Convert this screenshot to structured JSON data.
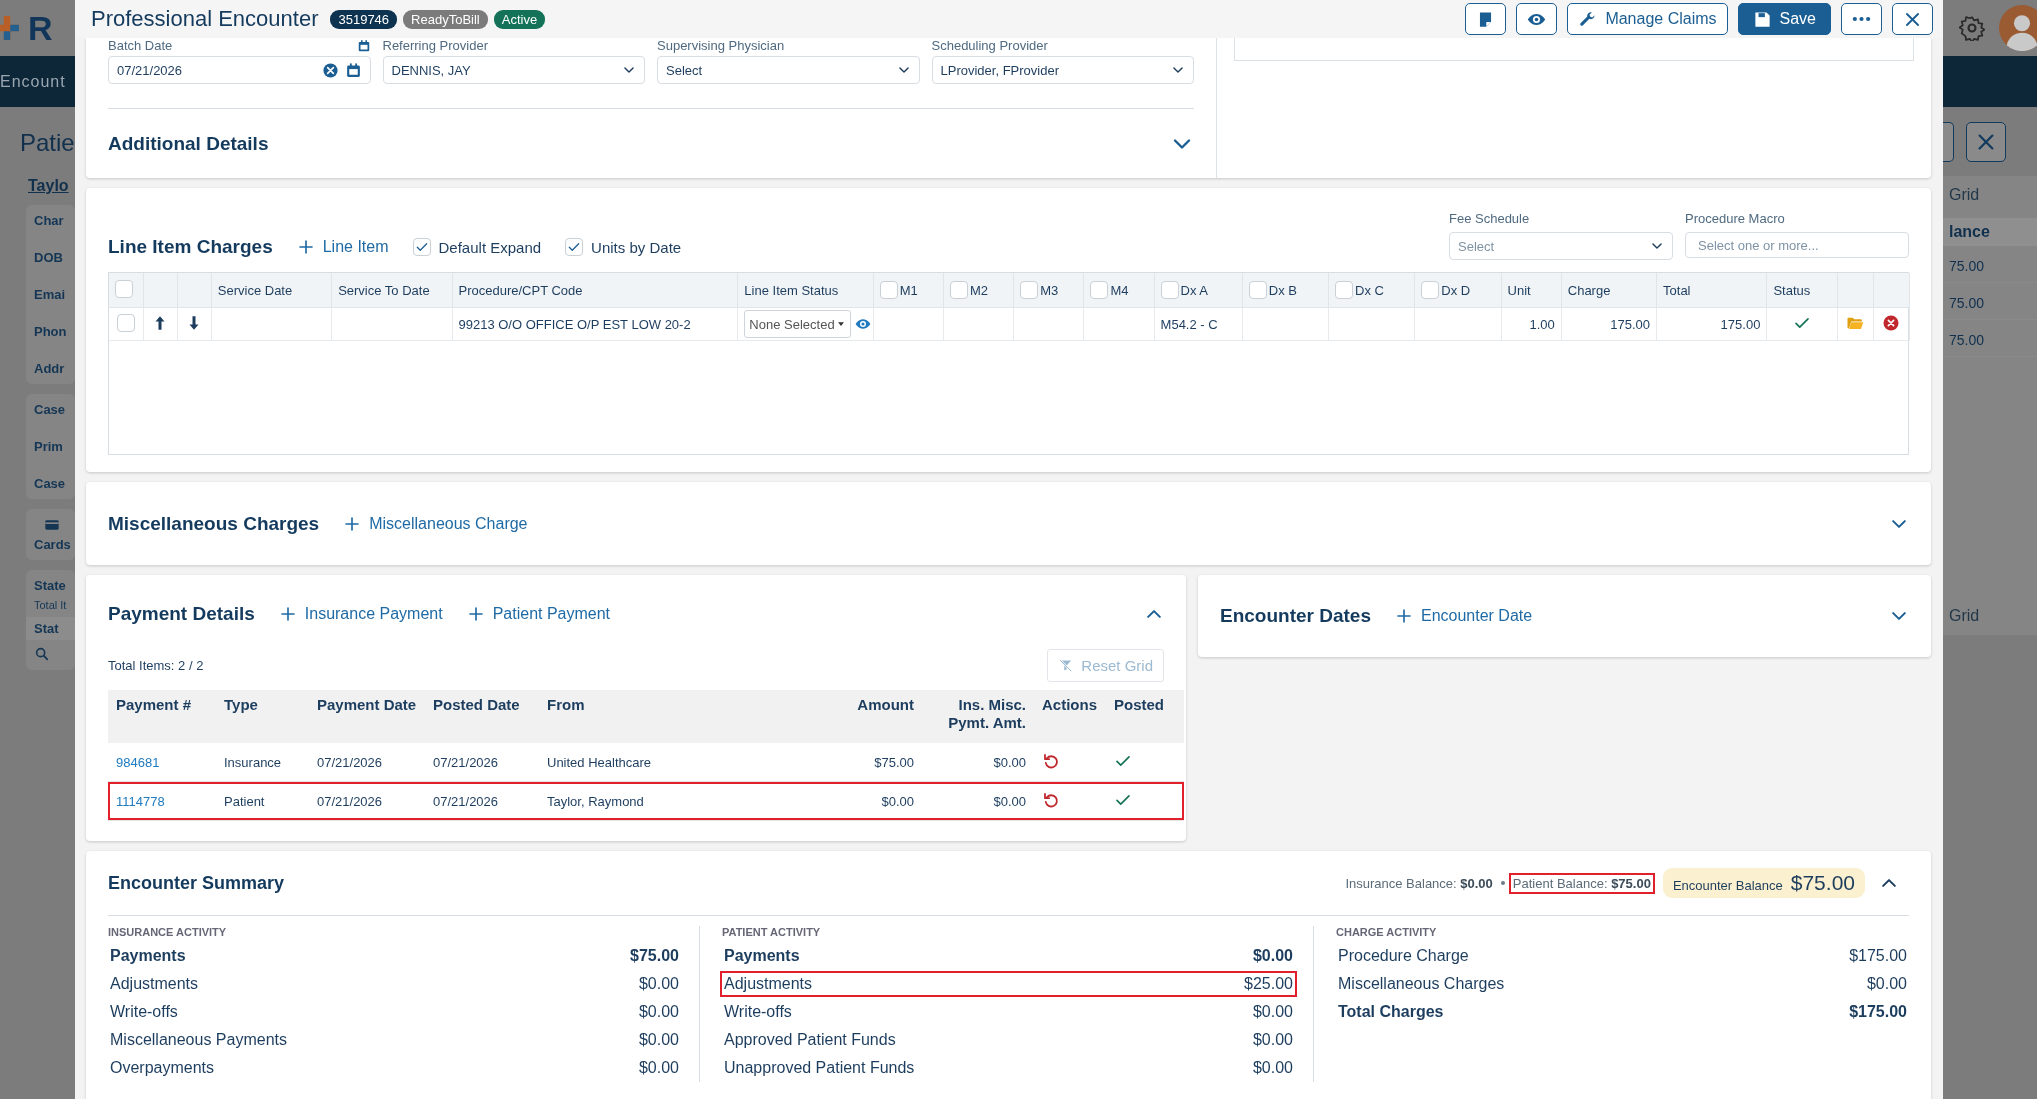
{
  "backdrop": {
    "left": {
      "logo_letter": "R",
      "nav_label": "Encount",
      "page_title": "Patie",
      "patient_name": "Taylo",
      "info_labels": [
        "Char",
        "DOB",
        "Emai",
        "Phon",
        "Addr"
      ],
      "case_labels": [
        "Case",
        "Prim",
        "Case"
      ],
      "cards_label": "Cards",
      "statements": {
        "title": "State",
        "total": "Total It",
        "column": "Stat"
      }
    },
    "right": {
      "grid_link": "Grid",
      "column": "lance",
      "values": [
        "75.00",
        "75.00",
        "75.00"
      ],
      "grid_link_2": "Grid"
    }
  },
  "modal": {
    "title": "Professional Encounter",
    "badges": [
      {
        "text": "3519746",
        "color": "#0d3350"
      },
      {
        "text": "ReadyToBill",
        "color": "#7b7b7b"
      },
      {
        "text": "Active",
        "color": "#137257"
      }
    ],
    "manage_claims": "Manage Claims",
    "save": "Save"
  },
  "encounter_info": {
    "fields": [
      {
        "label": "Batch Date",
        "value": "07/21/2026",
        "kind": "date"
      },
      {
        "label": "Referring Provider",
        "value": "DENNIS, JAY",
        "kind": "select"
      },
      {
        "label": "Supervising Physician",
        "value": "Select",
        "kind": "select"
      },
      {
        "label": "Scheduling Provider",
        "value": "LProvider, FProvider",
        "kind": "select"
      }
    ],
    "additional_details": {
      "title": "Additional Details",
      "expanded": false
    }
  },
  "line_items": {
    "title": "Line Item Charges",
    "add": "Line Item",
    "options": [
      {
        "label": "Default Expand",
        "checked": true
      },
      {
        "label": "Units by Date",
        "checked": true
      }
    ],
    "fee_schedule": {
      "label": "Fee Schedule",
      "value": "Select"
    },
    "procedure_macro": {
      "label": "Procedure Macro",
      "placeholder": "Select one or more..."
    },
    "select_all": {
      "checked": false
    },
    "columns": [
      {
        "label": "Service Date",
        "kind": "plain"
      },
      {
        "label": "Service To Date",
        "kind": "plain"
      },
      {
        "label": "Procedure/CPT Code",
        "kind": "plain"
      },
      {
        "label": "Line Item Status",
        "kind": "select"
      },
      {
        "label": "M1",
        "kind": "checkbox",
        "checked": false
      },
      {
        "label": "M2",
        "kind": "checkbox",
        "checked": false
      },
      {
        "label": "M3",
        "kind": "checkbox",
        "checked": false
      },
      {
        "label": "M4",
        "kind": "checkbox",
        "checked": false
      },
      {
        "label": "Dx A",
        "kind": "checkbox",
        "checked": false
      },
      {
        "label": "Dx B",
        "kind": "checkbox",
        "checked": false
      },
      {
        "label": "Dx C",
        "kind": "checkbox",
        "checked": false
      },
      {
        "label": "Dx D",
        "kind": "checkbox",
        "checked": false
      },
      {
        "label": "Unit",
        "kind": "number"
      },
      {
        "label": "Charge",
        "kind": "number"
      },
      {
        "label": "Total",
        "kind": "number"
      },
      {
        "label": "Status",
        "kind": "status"
      }
    ],
    "rows": [
      {
        "checked": false,
        "status_ok": true,
        "cells": [
          null,
          null,
          "99213 O/O OFFICE O/P EST LOW 20-2",
          "None Selected",
          null,
          null,
          null,
          null,
          "M54.2 - C",
          null,
          null,
          null,
          "1.00",
          "175.00",
          "175.00",
          null
        ]
      }
    ]
  },
  "misc_charges": {
    "title": "Miscellaneous Charges",
    "add": "Miscellaneous Charge",
    "expanded": false
  },
  "payment_details": {
    "title": "Payment Details",
    "add_insurance": "Insurance Payment",
    "add_patient": "Patient Payment",
    "expanded": true,
    "total_items": "Total Items: 2 / 2",
    "reset_grid": {
      "label": "Reset Grid",
      "disabled": true
    },
    "columns": [
      {
        "label": "Payment #",
        "kind": "link"
      },
      {
        "label": "Type",
        "kind": "plain"
      },
      {
        "label": "Payment Date",
        "kind": "plain"
      },
      {
        "label": "Posted Date",
        "kind": "plain"
      },
      {
        "label": "From",
        "kind": "plain"
      },
      {
        "label": "Amount",
        "kind": "number"
      },
      {
        "label": "Ins. Misc. Pymt. Amt.",
        "kind": "number"
      },
      {
        "label": "Actions",
        "kind": "action"
      },
      {
        "label": "Posted",
        "kind": "check"
      }
    ],
    "rows": [
      {
        "cells": [
          "984681",
          "Insurance",
          "07/21/2026",
          "07/21/2026",
          "United Healthcare",
          "$75.00",
          "$0.00",
          null,
          null
        ],
        "posted": true,
        "highlighted": false
      },
      {
        "cells": [
          "1114778",
          "Patient",
          "07/21/2026",
          "07/21/2026",
          "Taylor, Raymond",
          "$0.00",
          "$0.00",
          null,
          null
        ],
        "posted": true,
        "highlighted": true
      }
    ]
  },
  "encounter_dates": {
    "title": "Encounter Dates",
    "add": "Encounter Date",
    "expanded": false
  },
  "summary": {
    "title": "Encounter Summary",
    "expanded": true,
    "insurance_balance": {
      "text": "Insurance Balance: **$0.00**",
      "highlighted": false
    },
    "patient_balance": {
      "text": "Patient Balance: **$75.00**",
      "highlighted": true
    },
    "encounter_balance": {
      "label": "Encounter Balance",
      "value": "$75.00"
    },
    "groups": [
      {
        "title": "INSURANCE ACTIVITY",
        "rows": [
          {
            "label": "Payments",
            "value": "$75.00",
            "emphasis": true,
            "highlighted": false
          },
          {
            "label": "Adjustments",
            "value": "$0.00",
            "emphasis": false,
            "highlighted": false
          },
          {
            "label": "Write-offs",
            "value": "$0.00",
            "emphasis": false,
            "highlighted": false
          },
          {
            "label": "Miscellaneous Payments",
            "value": "$0.00",
            "emphasis": false,
            "highlighted": false
          },
          {
            "label": "Overpayments",
            "value": "$0.00",
            "emphasis": false,
            "highlighted": false
          }
        ]
      },
      {
        "title": "PATIENT ACTIVITY",
        "rows": [
          {
            "label": "Payments",
            "value": "$0.00",
            "emphasis": true,
            "highlighted": false
          },
          {
            "label": "Adjustments",
            "value": "$25.00",
            "emphasis": false,
            "highlighted": true
          },
          {
            "label": "Write-offs",
            "value": "$0.00",
            "emphasis": false,
            "highlighted": false
          },
          {
            "label": "Approved Patient Funds",
            "value": "$0.00",
            "emphasis": false,
            "highlighted": false
          },
          {
            "label": "Unapproved Patient Funds",
            "value": "$0.00",
            "emphasis": false,
            "highlighted": false
          }
        ]
      },
      {
        "title": "CHARGE ACTIVITY",
        "rows": [
          {
            "label": "Procedure Charge",
            "value": "$175.00",
            "emphasis": false,
            "highlighted": false
          },
          {
            "label": "Miscellaneous Charges",
            "value": "$0.00",
            "emphasis": false,
            "highlighted": false
          },
          {
            "label": "Total Charges",
            "value": "$175.00",
            "emphasis": true,
            "highlighted": false
          }
        ]
      }
    ]
  }
}
